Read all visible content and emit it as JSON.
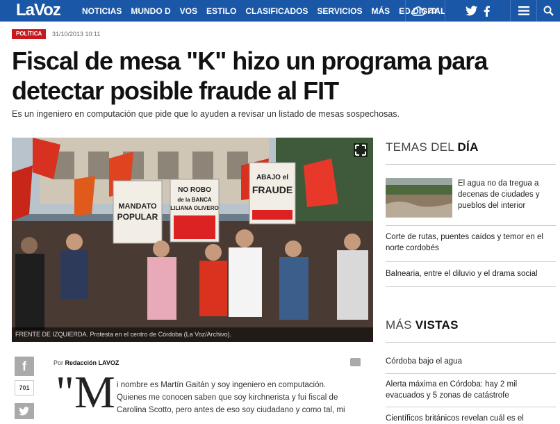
{
  "nav": {
    "logo_a": "La",
    "logo_b": "Voz",
    "items": [
      "NOTICIAS",
      "MUNDO D",
      "VOS",
      "ESTILO",
      "CLASIFICADOS",
      "SERVICIOS",
      "MÁS",
      "ED.DIGITAL"
    ],
    "weather": "20°",
    "bg_color": "#1a57a6"
  },
  "article": {
    "section": "POLÍTICA",
    "datetime": "31/10/2013 10:11",
    "title": "Fiscal de mesa \"K\" hizo un programa para detectar posible fraude al FIT",
    "subtitle": "Es un ingeniero en computación que pide que lo ayuden a revisar un listado de mesas sospechosas.",
    "photo_caption": "FRENTE DE IZQUIERDA. Protesta en el centro de Córdoba (La Voz/Archivo).",
    "photo_signs": [
      "NO ROBO de la banca de LILIANA OLIVERO",
      "ABAJO el FRAUDE",
      "RESPETO al MANDATO POPULAR"
    ],
    "share_count": "701",
    "byline_prefix": "Por",
    "byline_author": "Redacción LAVOZ",
    "drop_cap": "\"M",
    "body_lines": [
      "i nombre es Martín Gaitán y soy ingeniero en computación.",
      "Quienes me conocen saben que soy kirchnerista y fui fiscal de",
      "Carolina Scotto, pero antes de eso soy ciudadano y como tal, mi"
    ]
  },
  "sidebar": {
    "temas_light": "TEMAS DEL",
    "temas_bold": "DÍA",
    "temas": [
      "El agua no da tregua a decenas de ciudades y pueblos del interior",
      "Corte de rutas, puentes caídos y temor en el norte cordobés",
      "Balnearia, entre el diluvio y el drama social"
    ],
    "vistas_light": "MÁS",
    "vistas_bold": "VISTAS",
    "vistas": [
      "Córdoba bajo el agua",
      "Alerta máxima en Córdoba: hay 2 mil evacuados y 5 zonas de catástrofe",
      "Científicos británicos revelan cuál es el"
    ]
  }
}
